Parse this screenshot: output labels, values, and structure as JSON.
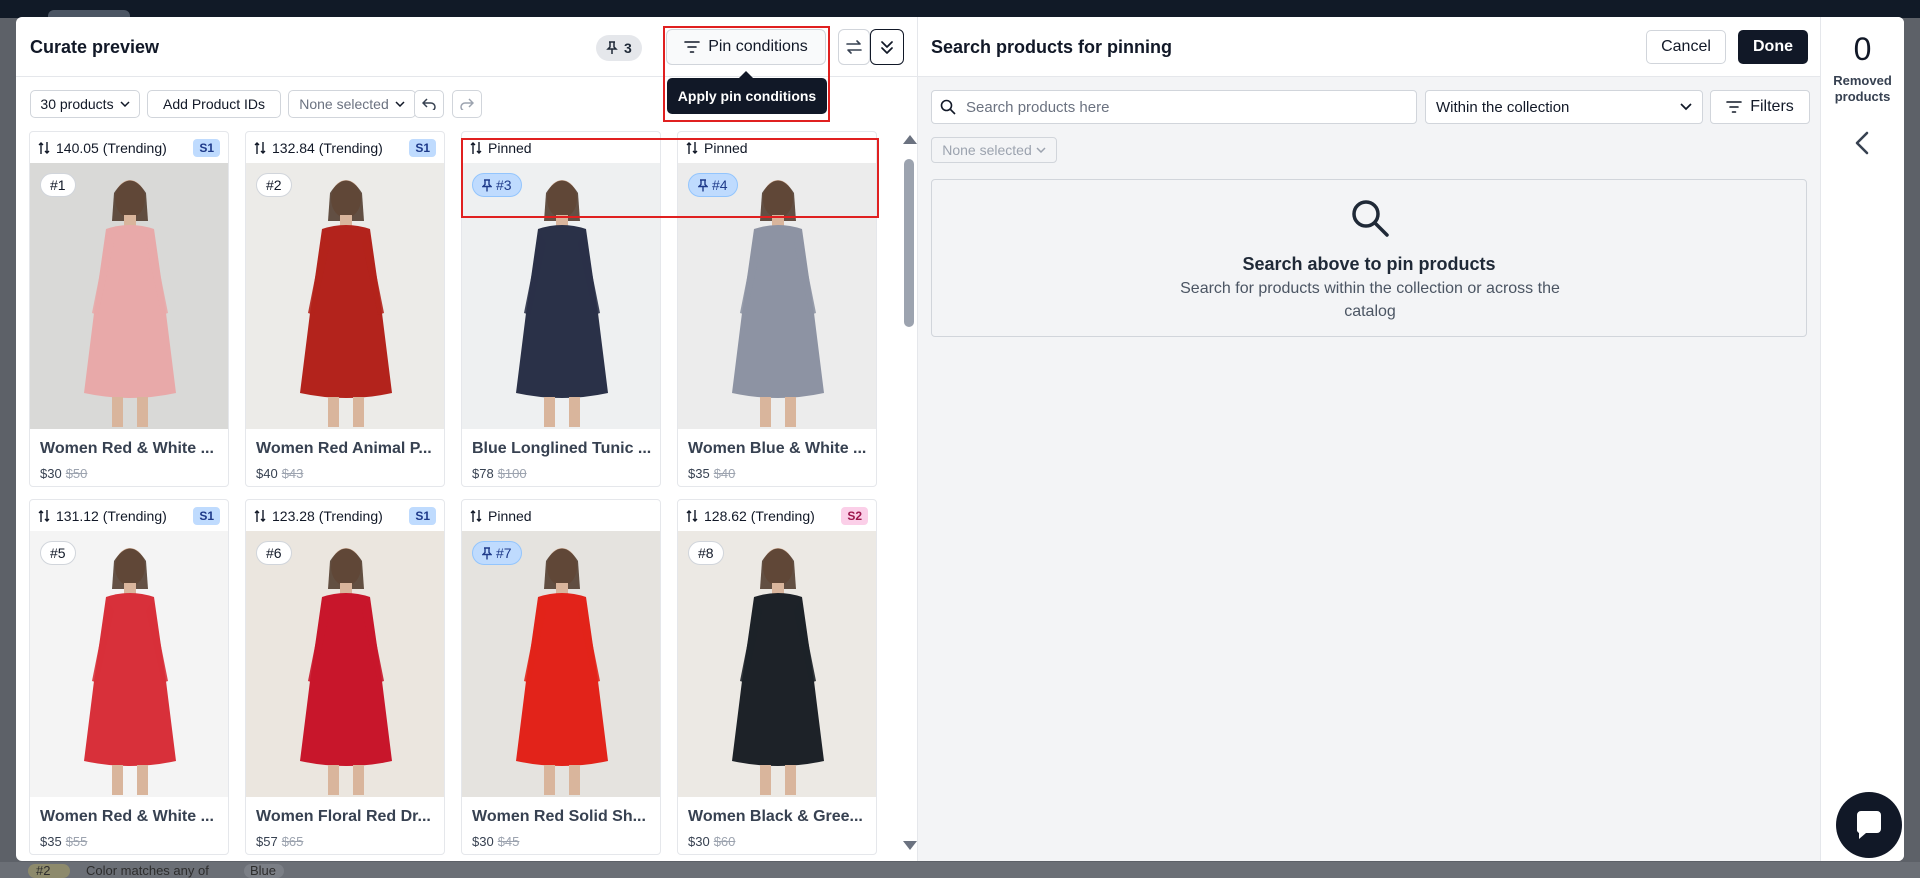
{
  "backdrop": {
    "bottom_badge": "#2",
    "bottom_text": "Color matches any of",
    "bottom_chip": "Blue"
  },
  "left": {
    "title": "Curate preview",
    "pin_count": "3",
    "pin_conditions_label": "Pin conditions",
    "tooltip": "Apply pin conditions",
    "toolbar": {
      "products_count": "30 products",
      "add_ids": "Add Product IDs",
      "none_selected": "None selected"
    }
  },
  "products": [
    {
      "score": "140.05 (Trending)",
      "segment": "S1",
      "rank": "#1",
      "pinned": false,
      "name": "Women Red & White ...",
      "price": "$30",
      "old_price": "$50",
      "dress_color": "#e8a9a9",
      "bg": "#d9d9d7"
    },
    {
      "score": "132.84 (Trending)",
      "segment": "S1",
      "rank": "#2",
      "pinned": false,
      "name": "Women Red Animal P...",
      "price": "$40",
      "old_price": "$43",
      "dress_color": "#b3231c",
      "bg": "#ecebe8"
    },
    {
      "score": "Pinned",
      "segment": "",
      "rank": "#3",
      "pinned": true,
      "name": "Blue Longlined Tunic ...",
      "price": "$78",
      "old_price": "$100",
      "dress_color": "#2a3148",
      "bg": "#eef0f1"
    },
    {
      "score": "Pinned",
      "segment": "",
      "rank": "#4",
      "pinned": true,
      "name": "Women Blue & White ...",
      "price": "$35",
      "old_price": "$40",
      "dress_color": "#8d93a3",
      "bg": "#ececec"
    },
    {
      "score": "131.12 (Trending)",
      "segment": "S1",
      "rank": "#5",
      "pinned": false,
      "name": "Women Red & White ...",
      "price": "$35",
      "old_price": "$55",
      "dress_color": "#d8303a",
      "bg": "#f4f4f4"
    },
    {
      "score": "123.28 (Trending)",
      "segment": "S1",
      "rank": "#6",
      "pinned": false,
      "name": "Women Floral Red Dr...",
      "price": "$57",
      "old_price": "$65",
      "dress_color": "#c8162b",
      "bg": "#ebe6df"
    },
    {
      "score": "Pinned",
      "segment": "",
      "rank": "#7",
      "pinned": true,
      "name": "Women Red Solid Sh...",
      "price": "$30",
      "old_price": "$45",
      "dress_color": "#e2231a",
      "bg": "#e5e3df"
    },
    {
      "score": "128.62 (Trending)",
      "segment": "S2",
      "rank": "#8",
      "pinned": false,
      "name": "Women Black & Gree...",
      "price": "$30",
      "old_price": "$60",
      "dress_color": "#1d2228",
      "bg": "#ece9e4"
    }
  ],
  "right": {
    "title": "Search products for pinning",
    "cancel": "Cancel",
    "done": "Done",
    "search_placeholder": "Search products here",
    "scope": "Within the collection",
    "filters": "Filters",
    "none_selected": "None selected",
    "empty_title": "Search above to pin products",
    "empty_text": "Search for products within the collection or across the catalog"
  },
  "rail": {
    "removed_count": "0",
    "removed_label": "Removed products"
  }
}
